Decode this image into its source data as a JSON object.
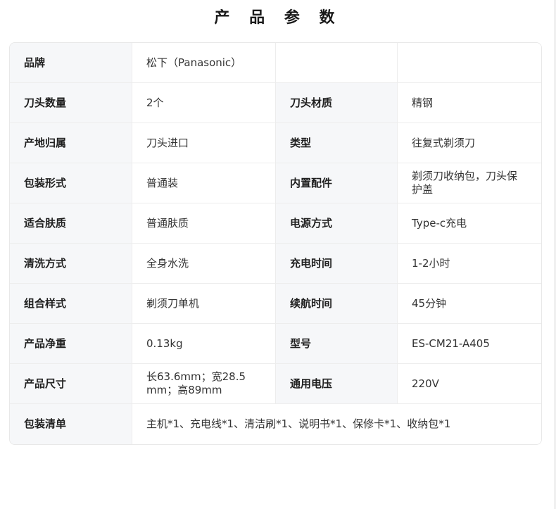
{
  "title": "产 品 参 数",
  "rows": [
    {
      "k1": "品牌",
      "v1": "松下（Panasonic）",
      "k2": "",
      "v2": ""
    },
    {
      "k1": "刀头数量",
      "v1": "2个",
      "k2": "刀头材质",
      "v2": "精钢"
    },
    {
      "k1": "产地归属",
      "v1": "刀头进口",
      "k2": "类型",
      "v2": "往复式剃须刀"
    },
    {
      "k1": "包装形式",
      "v1": "普通装",
      "k2": "内置配件",
      "v2": "剃须刀收纳包，刀头保护盖"
    },
    {
      "k1": "适合肤质",
      "v1": "普通肤质",
      "k2": "电源方式",
      "v2": "Type-c充电"
    },
    {
      "k1": "清洗方式",
      "v1": "全身水洗",
      "k2": "充电时间",
      "v2": "1-2小时"
    },
    {
      "k1": "组合样式",
      "v1": "剃须刀单机",
      "k2": "续航时间",
      "v2": "45分钟"
    },
    {
      "k1": "产品净重",
      "v1": "0.13kg",
      "k2": "型号",
      "v2": "ES-CM21-A405"
    },
    {
      "k1": "产品尺寸",
      "v1": "长63.6mm；宽28.5mm；高89mm",
      "k2": "通用电压",
      "v2": "220V"
    }
  ],
  "last_row": {
    "k": "包装清单",
    "v": "主机*1、充电线*1、清洁刷*1、说明书*1、保修卡*1、收纳包*1"
  }
}
